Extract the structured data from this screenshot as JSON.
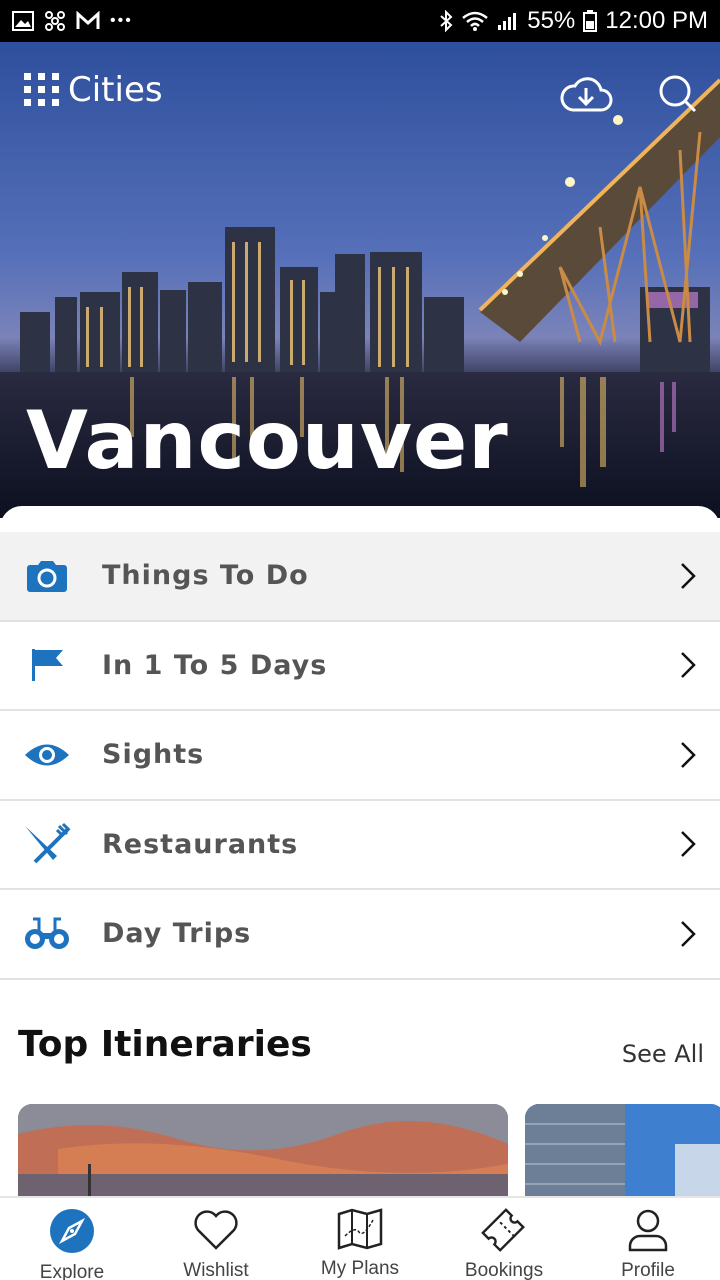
{
  "status_bar": {
    "battery": "55%",
    "time": "12:00 PM",
    "dots": "•••"
  },
  "header": {
    "logo_text": "Cities",
    "city_title": "Vancouver"
  },
  "menu": {
    "items": [
      {
        "label": "Things To Do",
        "icon": "camera-icon",
        "active": true
      },
      {
        "label": "In 1 To 5 Days",
        "icon": "flag-icon",
        "active": false
      },
      {
        "label": "Sights",
        "icon": "eye-icon",
        "active": false
      },
      {
        "label": "Restaurants",
        "icon": "utensils-icon",
        "active": false
      },
      {
        "label": "Day Trips",
        "icon": "binoculars-icon",
        "active": false
      }
    ]
  },
  "itineraries": {
    "title": "Top Itineraries",
    "see_all": "See All"
  },
  "bottom_nav": {
    "items": [
      {
        "label": "Explore",
        "icon": "compass-icon",
        "active": true
      },
      {
        "label": "Wishlist",
        "icon": "heart-icon",
        "active": false
      },
      {
        "label": "My Plans",
        "icon": "map-icon",
        "active": false
      },
      {
        "label": "Bookings",
        "icon": "ticket-icon",
        "active": false
      },
      {
        "label": "Profile",
        "icon": "person-icon",
        "active": false
      }
    ]
  },
  "colors": {
    "accent": "#1e73be",
    "status_bar": "#000000",
    "active_row": "#f2f2f2"
  }
}
